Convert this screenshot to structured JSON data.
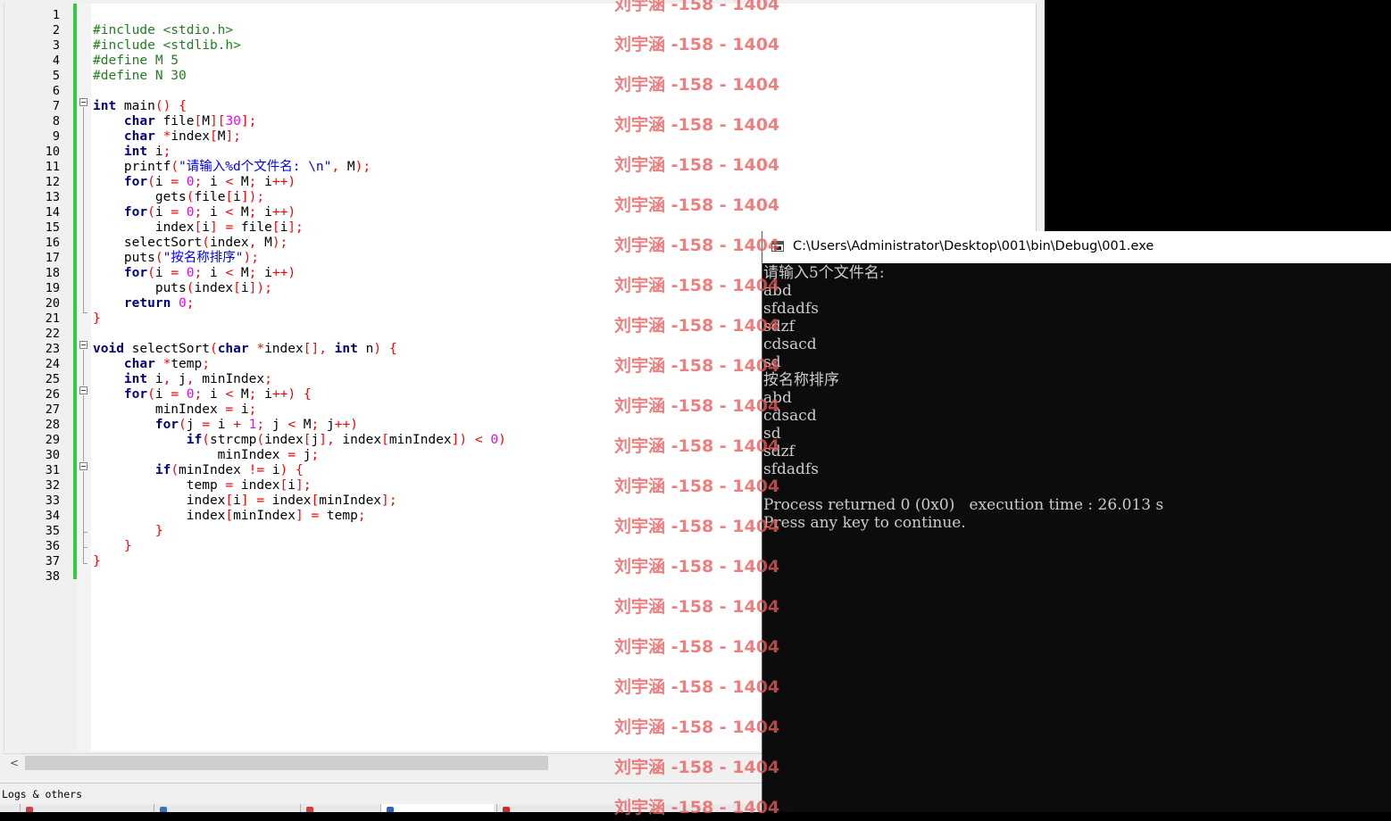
{
  "editor": {
    "line_numbers": [
      "1",
      "2",
      "3",
      "4",
      "5",
      "6",
      "7",
      "8",
      "9",
      "10",
      "11",
      "12",
      "13",
      "14",
      "15",
      "16",
      "17",
      "18",
      "19",
      "20",
      "21",
      "22",
      "23",
      "24",
      "25",
      "26",
      "27",
      "28",
      "29",
      "30",
      "31",
      "32",
      "33",
      "34",
      "35",
      "36",
      "37",
      "38"
    ],
    "code_lines": [
      [],
      [
        {
          "c": "pp",
          "t": "#include <stdio.h>"
        }
      ],
      [
        {
          "c": "pp",
          "t": "#include <stdlib.h>"
        }
      ],
      [
        {
          "c": "pp",
          "t": "#define M 5"
        }
      ],
      [
        {
          "c": "pp",
          "t": "#define N 30"
        }
      ],
      [],
      [
        {
          "c": "kw",
          "t": "int"
        },
        {
          "c": "",
          "t": " main"
        },
        {
          "c": "op",
          "t": "()"
        },
        {
          "c": "",
          "t": " "
        },
        {
          "c": "op",
          "t": "{"
        }
      ],
      [
        {
          "c": "",
          "t": "    "
        },
        {
          "c": "kw",
          "t": "char"
        },
        {
          "c": "",
          "t": " file"
        },
        {
          "c": "op",
          "t": "["
        },
        {
          "c": "",
          "t": "M"
        },
        {
          "c": "op",
          "t": "]["
        },
        {
          "c": "nm",
          "t": "30"
        },
        {
          "c": "op",
          "t": "];"
        }
      ],
      [
        {
          "c": "",
          "t": "    "
        },
        {
          "c": "kw",
          "t": "char"
        },
        {
          "c": "",
          "t": " "
        },
        {
          "c": "op",
          "t": "*"
        },
        {
          "c": "",
          "t": "index"
        },
        {
          "c": "op",
          "t": "["
        },
        {
          "c": "",
          "t": "M"
        },
        {
          "c": "op",
          "t": "];"
        }
      ],
      [
        {
          "c": "",
          "t": "    "
        },
        {
          "c": "kw",
          "t": "int"
        },
        {
          "c": "",
          "t": " i"
        },
        {
          "c": "op",
          "t": ";"
        }
      ],
      [
        {
          "c": "",
          "t": "    printf"
        },
        {
          "c": "op",
          "t": "("
        },
        {
          "c": "st",
          "t": "\"请输入%d个文件名: \\n\""
        },
        {
          "c": "op",
          "t": ","
        },
        {
          "c": "",
          "t": " M"
        },
        {
          "c": "op",
          "t": ");"
        }
      ],
      [
        {
          "c": "",
          "t": "    "
        },
        {
          "c": "kw",
          "t": "for"
        },
        {
          "c": "op",
          "t": "("
        },
        {
          "c": "",
          "t": "i "
        },
        {
          "c": "op",
          "t": "="
        },
        {
          "c": "",
          "t": " "
        },
        {
          "c": "nm",
          "t": "0"
        },
        {
          "c": "op",
          "t": ";"
        },
        {
          "c": "",
          "t": " i "
        },
        {
          "c": "op",
          "t": "<"
        },
        {
          "c": "",
          "t": " M"
        },
        {
          "c": "op",
          "t": ";"
        },
        {
          "c": "",
          "t": " i"
        },
        {
          "c": "op",
          "t": "++)"
        }
      ],
      [
        {
          "c": "",
          "t": "        gets"
        },
        {
          "c": "op",
          "t": "("
        },
        {
          "c": "",
          "t": "file"
        },
        {
          "c": "op",
          "t": "["
        },
        {
          "c": "",
          "t": "i"
        },
        {
          "c": "op",
          "t": "]);"
        }
      ],
      [
        {
          "c": "",
          "t": "    "
        },
        {
          "c": "kw",
          "t": "for"
        },
        {
          "c": "op",
          "t": "("
        },
        {
          "c": "",
          "t": "i "
        },
        {
          "c": "op",
          "t": "="
        },
        {
          "c": "",
          "t": " "
        },
        {
          "c": "nm",
          "t": "0"
        },
        {
          "c": "op",
          "t": ";"
        },
        {
          "c": "",
          "t": " i "
        },
        {
          "c": "op",
          "t": "<"
        },
        {
          "c": "",
          "t": " M"
        },
        {
          "c": "op",
          "t": ";"
        },
        {
          "c": "",
          "t": " i"
        },
        {
          "c": "op",
          "t": "++)"
        }
      ],
      [
        {
          "c": "",
          "t": "        index"
        },
        {
          "c": "op",
          "t": "["
        },
        {
          "c": "",
          "t": "i"
        },
        {
          "c": "op",
          "t": "]"
        },
        {
          "c": "",
          "t": " "
        },
        {
          "c": "op",
          "t": "="
        },
        {
          "c": "",
          "t": " file"
        },
        {
          "c": "op",
          "t": "["
        },
        {
          "c": "",
          "t": "i"
        },
        {
          "c": "op",
          "t": "];"
        }
      ],
      [
        {
          "c": "",
          "t": "    selectSort"
        },
        {
          "c": "op",
          "t": "("
        },
        {
          "c": "",
          "t": "index"
        },
        {
          "c": "op",
          "t": ","
        },
        {
          "c": "",
          "t": " M"
        },
        {
          "c": "op",
          "t": ");"
        }
      ],
      [
        {
          "c": "",
          "t": "    puts"
        },
        {
          "c": "op",
          "t": "("
        },
        {
          "c": "st",
          "t": "\"按名称排序\""
        },
        {
          "c": "op",
          "t": ");"
        }
      ],
      [
        {
          "c": "",
          "t": "    "
        },
        {
          "c": "kw",
          "t": "for"
        },
        {
          "c": "op",
          "t": "("
        },
        {
          "c": "",
          "t": "i "
        },
        {
          "c": "op",
          "t": "="
        },
        {
          "c": "",
          "t": " "
        },
        {
          "c": "nm",
          "t": "0"
        },
        {
          "c": "op",
          "t": ";"
        },
        {
          "c": "",
          "t": " i "
        },
        {
          "c": "op",
          "t": "<"
        },
        {
          "c": "",
          "t": " M"
        },
        {
          "c": "op",
          "t": ";"
        },
        {
          "c": "",
          "t": " i"
        },
        {
          "c": "op",
          "t": "++)"
        }
      ],
      [
        {
          "c": "",
          "t": "        puts"
        },
        {
          "c": "op",
          "t": "("
        },
        {
          "c": "",
          "t": "index"
        },
        {
          "c": "op",
          "t": "["
        },
        {
          "c": "",
          "t": "i"
        },
        {
          "c": "op",
          "t": "]);"
        }
      ],
      [
        {
          "c": "",
          "t": "    "
        },
        {
          "c": "kw",
          "t": "return"
        },
        {
          "c": "",
          "t": " "
        },
        {
          "c": "nm",
          "t": "0"
        },
        {
          "c": "op",
          "t": ";"
        }
      ],
      [
        {
          "c": "op",
          "t": "}"
        }
      ],
      [],
      [
        {
          "c": "kw",
          "t": "void"
        },
        {
          "c": "",
          "t": " selectSort"
        },
        {
          "c": "op",
          "t": "("
        },
        {
          "c": "kw",
          "t": "char"
        },
        {
          "c": "",
          "t": " "
        },
        {
          "c": "op",
          "t": "*"
        },
        {
          "c": "",
          "t": "index"
        },
        {
          "c": "op",
          "t": "[],"
        },
        {
          "c": "",
          "t": " "
        },
        {
          "c": "kw",
          "t": "int"
        },
        {
          "c": "",
          "t": " n"
        },
        {
          "c": "op",
          "t": ")"
        },
        {
          "c": "",
          "t": " "
        },
        {
          "c": "op",
          "t": "{"
        }
      ],
      [
        {
          "c": "",
          "t": "    "
        },
        {
          "c": "kw",
          "t": "char"
        },
        {
          "c": "",
          "t": " "
        },
        {
          "c": "op",
          "t": "*"
        },
        {
          "c": "",
          "t": "temp"
        },
        {
          "c": "op",
          "t": ";"
        }
      ],
      [
        {
          "c": "",
          "t": "    "
        },
        {
          "c": "kw",
          "t": "int"
        },
        {
          "c": "",
          "t": " i"
        },
        {
          "c": "op",
          "t": ","
        },
        {
          "c": "",
          "t": " j"
        },
        {
          "c": "op",
          "t": ","
        },
        {
          "c": "",
          "t": " minIndex"
        },
        {
          "c": "op",
          "t": ";"
        }
      ],
      [
        {
          "c": "",
          "t": "    "
        },
        {
          "c": "kw",
          "t": "for"
        },
        {
          "c": "op",
          "t": "("
        },
        {
          "c": "",
          "t": "i "
        },
        {
          "c": "op",
          "t": "="
        },
        {
          "c": "",
          "t": " "
        },
        {
          "c": "nm",
          "t": "0"
        },
        {
          "c": "op",
          "t": ";"
        },
        {
          "c": "",
          "t": " i "
        },
        {
          "c": "op",
          "t": "<"
        },
        {
          "c": "",
          "t": " M"
        },
        {
          "c": "op",
          "t": ";"
        },
        {
          "c": "",
          "t": " i"
        },
        {
          "c": "op",
          "t": "++)"
        },
        {
          "c": "",
          "t": " "
        },
        {
          "c": "op",
          "t": "{"
        }
      ],
      [
        {
          "c": "",
          "t": "        minIndex "
        },
        {
          "c": "op",
          "t": "="
        },
        {
          "c": "",
          "t": " i"
        },
        {
          "c": "op",
          "t": ";"
        }
      ],
      [
        {
          "c": "",
          "t": "        "
        },
        {
          "c": "kw",
          "t": "for"
        },
        {
          "c": "op",
          "t": "("
        },
        {
          "c": "",
          "t": "j "
        },
        {
          "c": "op",
          "t": "="
        },
        {
          "c": "",
          "t": " i "
        },
        {
          "c": "op",
          "t": "+"
        },
        {
          "c": "",
          "t": " "
        },
        {
          "c": "nm",
          "t": "1"
        },
        {
          "c": "op",
          "t": ";"
        },
        {
          "c": "",
          "t": " j "
        },
        {
          "c": "op",
          "t": "<"
        },
        {
          "c": "",
          "t": " M"
        },
        {
          "c": "op",
          "t": ";"
        },
        {
          "c": "",
          "t": " j"
        },
        {
          "c": "op",
          "t": "++)"
        }
      ],
      [
        {
          "c": "",
          "t": "            "
        },
        {
          "c": "kw",
          "t": "if"
        },
        {
          "c": "op",
          "t": "("
        },
        {
          "c": "",
          "t": "strcmp"
        },
        {
          "c": "op",
          "t": "("
        },
        {
          "c": "",
          "t": "index"
        },
        {
          "c": "op",
          "t": "["
        },
        {
          "c": "",
          "t": "j"
        },
        {
          "c": "op",
          "t": "],"
        },
        {
          "c": "",
          "t": " index"
        },
        {
          "c": "op",
          "t": "["
        },
        {
          "c": "",
          "t": "minIndex"
        },
        {
          "c": "op",
          "t": "])"
        },
        {
          "c": "",
          "t": " "
        },
        {
          "c": "op",
          "t": "<"
        },
        {
          "c": "",
          "t": " "
        },
        {
          "c": "nm",
          "t": "0"
        },
        {
          "c": "op",
          "t": ")"
        }
      ],
      [
        {
          "c": "",
          "t": "                minIndex "
        },
        {
          "c": "op",
          "t": "="
        },
        {
          "c": "",
          "t": " j"
        },
        {
          "c": "op",
          "t": ";"
        }
      ],
      [
        {
          "c": "",
          "t": "        "
        },
        {
          "c": "kw",
          "t": "if"
        },
        {
          "c": "op",
          "t": "("
        },
        {
          "c": "",
          "t": "minIndex "
        },
        {
          "c": "op",
          "t": "!="
        },
        {
          "c": "",
          "t": " i"
        },
        {
          "c": "op",
          "t": ")"
        },
        {
          "c": "",
          "t": " "
        },
        {
          "c": "op",
          "t": "{"
        }
      ],
      [
        {
          "c": "",
          "t": "            temp "
        },
        {
          "c": "op",
          "t": "="
        },
        {
          "c": "",
          "t": " index"
        },
        {
          "c": "op",
          "t": "["
        },
        {
          "c": "",
          "t": "i"
        },
        {
          "c": "op",
          "t": "];"
        }
      ],
      [
        {
          "c": "",
          "t": "            index"
        },
        {
          "c": "op",
          "t": "["
        },
        {
          "c": "",
          "t": "i"
        },
        {
          "c": "op",
          "t": "]"
        },
        {
          "c": "",
          "t": " "
        },
        {
          "c": "op",
          "t": "="
        },
        {
          "c": "",
          "t": " index"
        },
        {
          "c": "op",
          "t": "["
        },
        {
          "c": "",
          "t": "minIndex"
        },
        {
          "c": "op",
          "t": "];"
        }
      ],
      [
        {
          "c": "",
          "t": "            index"
        },
        {
          "c": "op",
          "t": "["
        },
        {
          "c": "",
          "t": "minIndex"
        },
        {
          "c": "op",
          "t": "]"
        },
        {
          "c": "",
          "t": " "
        },
        {
          "c": "op",
          "t": "="
        },
        {
          "c": "",
          "t": " temp"
        },
        {
          "c": "op",
          "t": ";"
        }
      ],
      [
        {
          "c": "",
          "t": "        "
        },
        {
          "c": "op",
          "t": "}"
        }
      ],
      [
        {
          "c": "",
          "t": "    "
        },
        {
          "c": "op",
          "t": "}"
        }
      ],
      [
        {
          "c": "op",
          "t": "}"
        }
      ],
      []
    ],
    "logs_title": "Logs & others"
  },
  "watermark": {
    "text": "刘宇涵 -158 - 1404",
    "repeat_count": 21
  },
  "console": {
    "title": "C:\\Users\\Administrator\\Desktop\\001\\bin\\Debug\\001.exe",
    "lines": [
      "请输入5个文件名:",
      "abd",
      "sfdadfs",
      "sdzf",
      "cdsacd",
      "sd",
      "按名称排序",
      "abd",
      "cdsacd",
      "sd",
      "sdzf",
      "sfdadfs",
      "",
      "Process returned 0 (0x0)   execution time : 26.013 s",
      "Press any key to continue."
    ]
  },
  "colors": {
    "keyword": "#000080",
    "preprocessor": "#208020",
    "operator": "#ff0000",
    "number": "#f000f0",
    "string": "#0000ff",
    "change_bar": "#2ecc40",
    "watermark": "#eb5a5a"
  }
}
